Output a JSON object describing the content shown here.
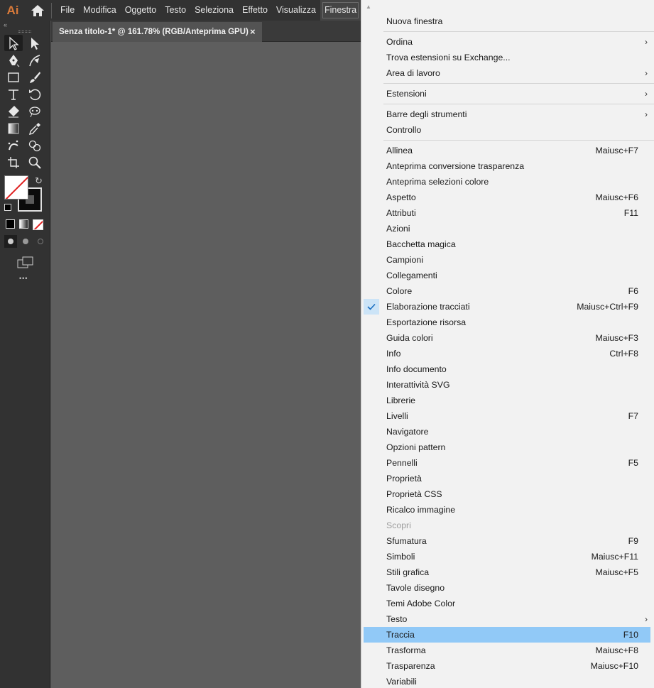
{
  "app": {
    "logo": "Ai"
  },
  "menubar": {
    "items": [
      {
        "label": "File",
        "active": false
      },
      {
        "label": "Modifica",
        "active": false
      },
      {
        "label": "Oggetto",
        "active": false
      },
      {
        "label": "Testo",
        "active": false
      },
      {
        "label": "Seleziona",
        "active": false
      },
      {
        "label": "Effetto",
        "active": false
      },
      {
        "label": "Visualizza",
        "active": false
      },
      {
        "label": "Finestra",
        "active": true
      }
    ]
  },
  "document": {
    "tab_title": "Senza titolo-1* @ 161.78% (RGB/Anteprima GPU)",
    "close_glyph": "×"
  },
  "toolbar": {
    "collapse_glyph": "«",
    "more_glyph": "•••",
    "tools": [
      [
        "selection-icon",
        "direct-selection-icon"
      ],
      [
        "pen-icon",
        "curvature-icon"
      ],
      [
        "rectangle-icon",
        "paintbrush-icon"
      ],
      [
        "type-icon",
        "rotate-icon"
      ],
      [
        "eraser-icon",
        "puppet-warp-icon"
      ],
      [
        "gradient-icon",
        "eyedropper-icon"
      ],
      [
        "symbol-sprayer-icon",
        "shape-builder-icon"
      ],
      [
        "artboard-icon",
        "zoom-icon"
      ]
    ]
  },
  "window_menu": {
    "scroll_glyph": "▲",
    "groups": [
      [
        {
          "label": "Nuova finestra",
          "shortcut": "",
          "submenu": false
        }
      ],
      [
        {
          "label": "Ordina",
          "shortcut": "",
          "submenu": true
        },
        {
          "label": "Trova estensioni su Exchange...",
          "shortcut": "",
          "submenu": false
        },
        {
          "label": "Area di lavoro",
          "shortcut": "",
          "submenu": true
        }
      ],
      [
        {
          "label": "Estensioni",
          "shortcut": "",
          "submenu": true
        }
      ],
      [
        {
          "label": "Barre degli strumenti",
          "shortcut": "",
          "submenu": true
        },
        {
          "label": "Controllo",
          "shortcut": "",
          "submenu": false
        }
      ],
      [
        {
          "label": "Allinea",
          "shortcut": "Maiusc+F7"
        },
        {
          "label": "Anteprima conversione trasparenza",
          "shortcut": ""
        },
        {
          "label": "Anteprima selezioni colore",
          "shortcut": ""
        },
        {
          "label": "Aspetto",
          "shortcut": "Maiusc+F6"
        },
        {
          "label": "Attributi",
          "shortcut": "F11"
        },
        {
          "label": "Azioni",
          "shortcut": ""
        },
        {
          "label": "Bacchetta magica",
          "shortcut": ""
        },
        {
          "label": "Campioni",
          "shortcut": ""
        },
        {
          "label": "Collegamenti",
          "shortcut": ""
        },
        {
          "label": "Colore",
          "shortcut": "F6"
        },
        {
          "label": "Elaborazione tracciati",
          "shortcut": "Maiusc+Ctrl+F9",
          "checked": true
        },
        {
          "label": "Esportazione risorsa",
          "shortcut": ""
        },
        {
          "label": "Guida colori",
          "shortcut": "Maiusc+F3"
        },
        {
          "label": "Info",
          "shortcut": "Ctrl+F8"
        },
        {
          "label": "Info documento",
          "shortcut": ""
        },
        {
          "label": "Interattività SVG",
          "shortcut": ""
        },
        {
          "label": "Librerie",
          "shortcut": ""
        },
        {
          "label": "Livelli",
          "shortcut": "F7"
        },
        {
          "label": "Navigatore",
          "shortcut": ""
        },
        {
          "label": "Opzioni pattern",
          "shortcut": ""
        },
        {
          "label": "Pennelli",
          "shortcut": "F5"
        },
        {
          "label": "Proprietà",
          "shortcut": ""
        },
        {
          "label": "Proprietà CSS",
          "shortcut": ""
        },
        {
          "label": "Ricalco immagine",
          "shortcut": ""
        },
        {
          "label": "Scopri",
          "shortcut": "",
          "disabled": true
        },
        {
          "label": "Sfumatura",
          "shortcut": "F9"
        },
        {
          "label": "Simboli",
          "shortcut": "Maiusc+F11"
        },
        {
          "label": "Stili grafica",
          "shortcut": "Maiusc+F5"
        },
        {
          "label": "Tavole disegno",
          "shortcut": ""
        },
        {
          "label": "Temi Adobe Color",
          "shortcut": ""
        },
        {
          "label": "Testo",
          "shortcut": "",
          "submenu": true
        },
        {
          "label": "Traccia",
          "shortcut": "F10",
          "highlighted": true
        },
        {
          "label": "Trasforma",
          "shortcut": "Maiusc+F8"
        },
        {
          "label": "Trasparenza",
          "shortcut": "Maiusc+F10"
        },
        {
          "label": "Variabili",
          "shortcut": ""
        }
      ]
    ]
  },
  "colors": {
    "highlight": "#91c9f7",
    "check_bg": "#cce4f7",
    "logo": "#d87a3a",
    "stroke_none": "#e02020"
  }
}
